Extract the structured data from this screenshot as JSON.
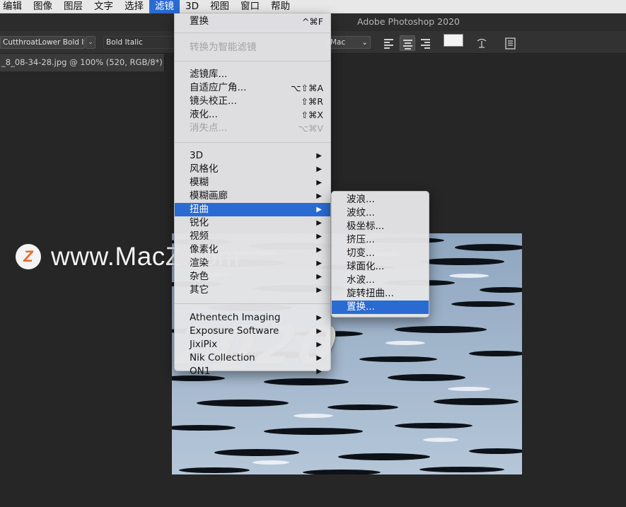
{
  "menubar": {
    "items": [
      "编辑",
      "图像",
      "图层",
      "文字",
      "选择",
      "滤镜",
      "3D",
      "视图",
      "窗口",
      "帮助"
    ],
    "active_index": 5
  },
  "app_title": "Adobe Photoshop 2020",
  "options_bar": {
    "font_family": "CutthroatLower Bold It...",
    "font_style": "Bold Italic",
    "antialias": "Mac"
  },
  "document_tab": "_8_08-34-28.jpg @ 100% (520, RGB/8*) *",
  "filter_menu": {
    "group1": [
      {
        "label": "置换",
        "shortcut": "^⌘F",
        "disabled": false
      }
    ],
    "group2": [
      {
        "label": "转换为智能滤镜",
        "disabled": true
      }
    ],
    "group3": [
      {
        "label": "滤镜库...",
        "shortcut": "",
        "disabled": false
      },
      {
        "label": "自适应广角...",
        "shortcut": "⌥⇧⌘A",
        "disabled": false
      },
      {
        "label": "镜头校正...",
        "shortcut": "⇧⌘R",
        "disabled": false
      },
      {
        "label": "液化...",
        "shortcut": "⇧⌘X",
        "disabled": false
      },
      {
        "label": "消失点...",
        "shortcut": "⌥⌘V",
        "disabled": true
      }
    ],
    "group4": [
      "3D",
      "风格化",
      "模糊",
      "模糊画廊",
      "扭曲",
      "锐化",
      "视频",
      "像素化",
      "渲染",
      "杂色",
      "其它"
    ],
    "group4_highlight": 4,
    "group5": [
      "Athentech Imaging",
      "Exposure Software",
      "JixiPix",
      "Nik Collection",
      "ON1"
    ]
  },
  "distort_submenu": {
    "items": [
      "波浪...",
      "波纹...",
      "极坐标...",
      "挤压...",
      "切变...",
      "球面化...",
      "水波...",
      "旋转扭曲...",
      "置换..."
    ],
    "highlight": 8
  },
  "canvas_text": "2020",
  "watermark": {
    "logo_letter": "Z",
    "text": "www.MacZ.com"
  },
  "colors": {
    "menu_highlight": "#2a6ad3",
    "app_bg": "#262626",
    "menubar_bg": "#e9e8e8"
  }
}
